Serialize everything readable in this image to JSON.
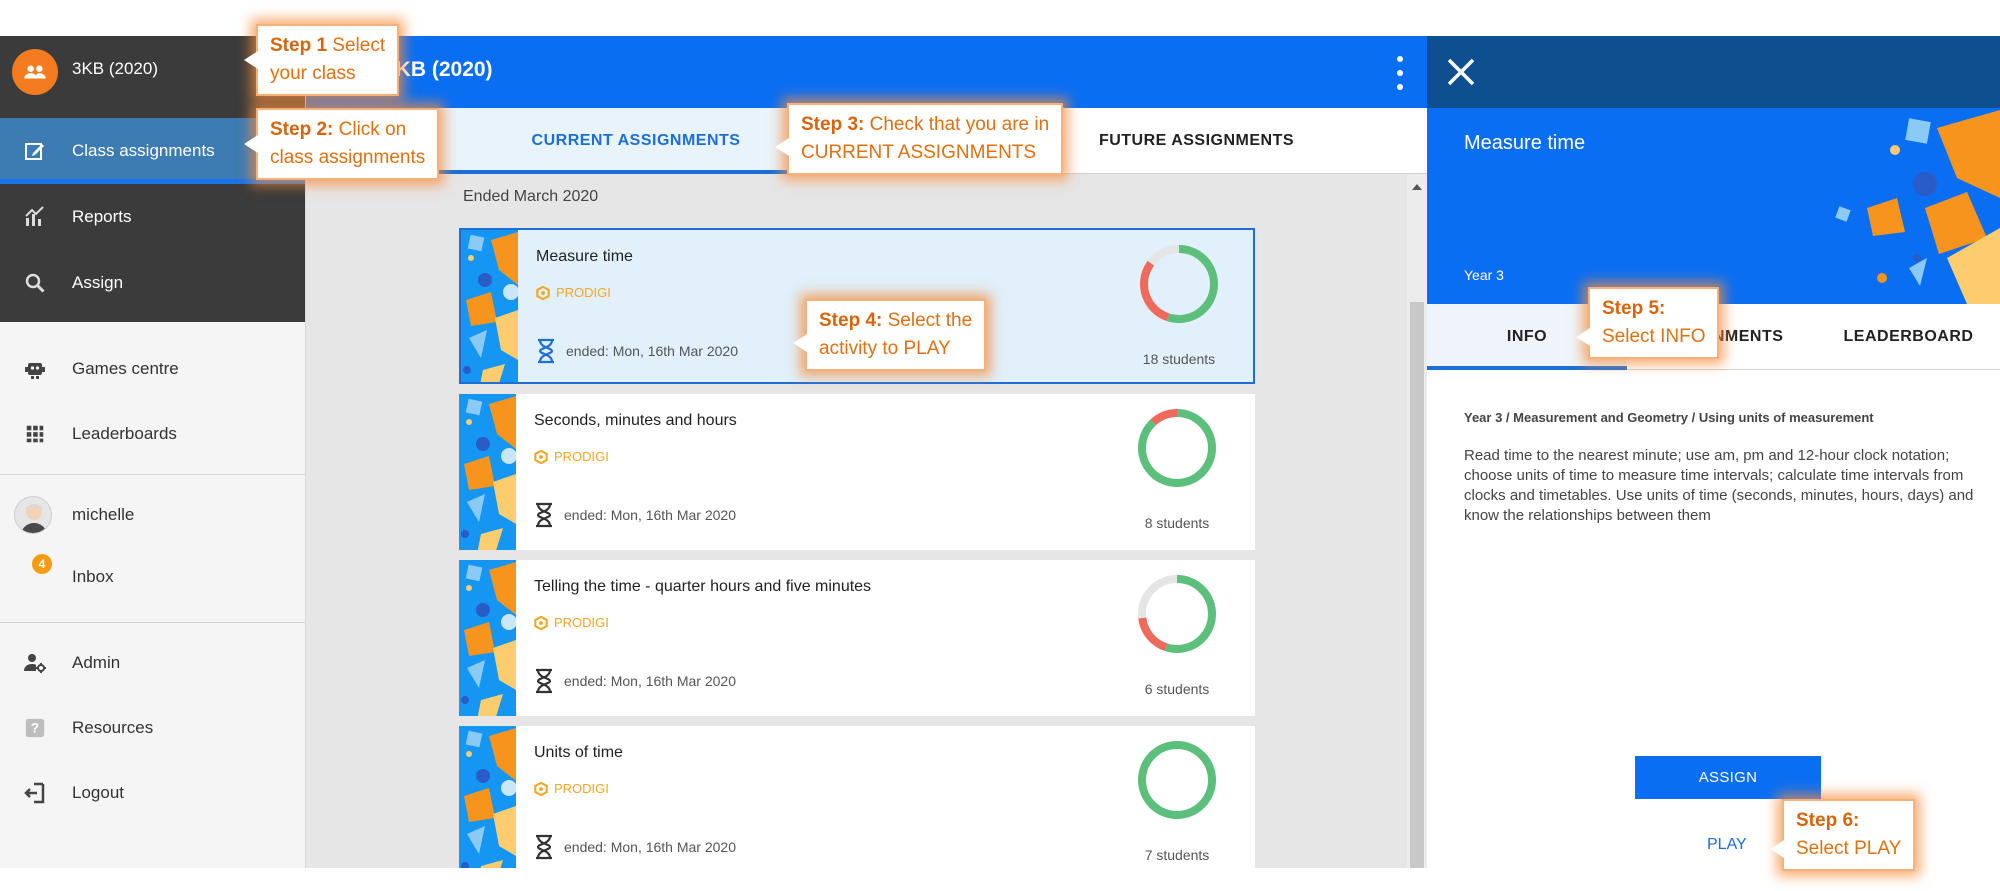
{
  "sidebar": {
    "class_name": "3KB (2020)",
    "items": [
      {
        "label": "Class assignments",
        "icon": "edit-icon"
      },
      {
        "label": "Reports",
        "icon": "chart-icon"
      },
      {
        "label": "Assign",
        "icon": "search-icon"
      },
      {
        "label": "Games centre",
        "icon": "robot-icon"
      },
      {
        "label": "Leaderboards",
        "icon": "grid-icon"
      },
      {
        "label": "michelle",
        "icon": "user-avatar"
      },
      {
        "label": "Inbox",
        "icon": "inbox-badge",
        "badge": "4"
      },
      {
        "label": "Admin",
        "icon": "admin-icon"
      },
      {
        "label": "Resources",
        "icon": "help-icon"
      },
      {
        "label": "Logout",
        "icon": "logout-icon"
      }
    ]
  },
  "header": {
    "title": "3KB (2020)"
  },
  "tabs": {
    "current": "CURRENT ASSIGNMENTS",
    "future": "FUTURE ASSIGNMENTS"
  },
  "section_label": "Ended March 2020",
  "assignments": [
    {
      "title": "Measure time",
      "source": "PRODIGI",
      "ended": "ended: Mon, 16th Mar 2020",
      "students": "18 students",
      "completion": 0.55,
      "partial": 0.3
    },
    {
      "title": "Seconds, minutes and hours",
      "source": "PRODIGI",
      "ended": "ended: Mon, 16th Mar 2020",
      "students": "8 students",
      "completion": 0.88,
      "partial": 0.12
    },
    {
      "title": "Telling the time - quarter hours and five minutes",
      "source": "PRODIGI",
      "ended": "ended: Mon, 16th Mar 2020",
      "students": "6 students",
      "completion": 0.55,
      "partial": 0.18
    },
    {
      "title": "Units of time",
      "source": "PRODIGI",
      "ended": "ended: Mon, 16th Mar 2020",
      "students": "7 students",
      "completion": 1.0,
      "partial": 0.0
    }
  ],
  "panel": {
    "title": "Measure time",
    "year": "Year 3",
    "tabs": {
      "info": "INFO",
      "assignments": "ASSIGNMENTS",
      "leaderboard": "LEADERBOARD"
    },
    "breadcrumb": "Year 3  /  Measurement and Geometry  /  Using units of measurement",
    "description": "Read time to the nearest minute; use am, pm and 12-hour clock notation; choose units of time to measure time intervals; calculate time intervals from clocks and timetables. Use units of time (seconds, minutes, hours, days) and know the relationships between them",
    "assign_button": "ASSIGN",
    "play_link": "PLAY"
  },
  "callouts": {
    "step1": {
      "bold": "Step 1",
      "text1": " Select",
      "text2": "your class"
    },
    "step2": {
      "bold": "Step 2:",
      "text1": " Click on",
      "text2": "class assignments"
    },
    "step3": {
      "bold": "Step 3:",
      "text1": " Check that you are in",
      "text2": "CURRENT ASSIGNMENTS"
    },
    "step4": {
      "bold": "Step 4:",
      "text1": " Select the",
      "text2": "activity to PLAY"
    },
    "step5": {
      "bold": "Step 5:",
      "text1": "",
      "text2": "Select INFO"
    },
    "step6": {
      "bold": "Step 6:",
      "text1": "",
      "text2": "Select PLAY"
    }
  },
  "colors": {
    "primary_blue": "#0a6ef3",
    "dark_header": "#0d4f8f",
    "sidebar_dark": "#3b3b3b",
    "orange_accent": "#f47c20",
    "donut_green": "#5cbf7c",
    "donut_red": "#f06a5b",
    "donut_grey": "#e5e5e5",
    "prodigi_orange": "#f5a623"
  }
}
